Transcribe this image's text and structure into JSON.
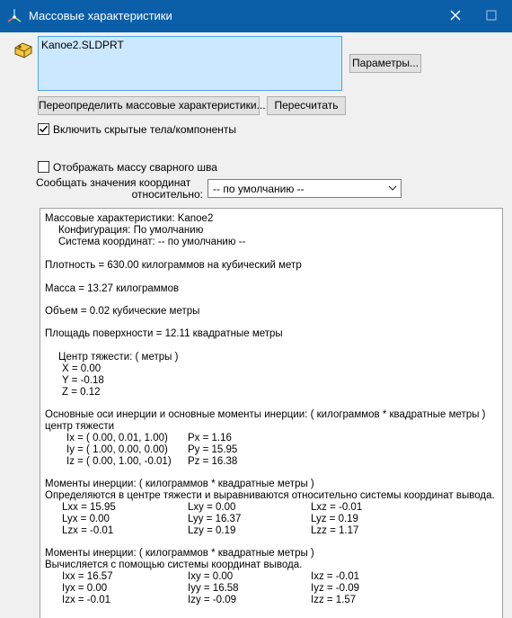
{
  "window": {
    "title": "Массовые характеристики"
  },
  "selection": {
    "items": [
      "Kanoe2.SLDPRT"
    ]
  },
  "buttons": {
    "params": "Параметры...",
    "override": "Переопределить массовые характеристики...",
    "recalculate": "Пересчитать"
  },
  "options": {
    "include_hidden": {
      "label": "Включить скрытые тела/компоненты",
      "checked": true
    },
    "show_weld_mass": {
      "label": "Отображать массу сварного шва",
      "checked": false
    }
  },
  "coord": {
    "label_line1": "Сообщать значения координат",
    "label_line2": "относительно:",
    "selected": "-- по умолчанию --"
  },
  "results": {
    "header": "Массовые характеристики: Kanoe2",
    "config": "Конфигурация: По умолчанию",
    "coord_system": "Система координат: -- по умолчанию --",
    "density": "Плотность = 630.00 килограммов на кубический метр",
    "mass": "Масса = 13.27 килограммов",
    "volume": "Объем = 0.02 кубические метры",
    "surface_area": "Площадь поверхности = 12.11 квадратные метры",
    "cog_title": "Центр тяжести: ( метры )",
    "cog": {
      "x": "X = 0.00",
      "y": "Y = -0.18",
      "z": "Z = 0.12"
    },
    "principal_title": "Основные оси инерции и основные моменты инерции: ( килограммов * квадратные метры )",
    "principal_sub": "центр тяжести",
    "principal_rows": [
      {
        "axis": "Ix = ( 0.00,  0.01,  1.00)",
        "moment": "Px = 1.16"
      },
      {
        "axis": "Iy = ( 1.00,  0.00,  0.00)",
        "moment": "Py = 15.95"
      },
      {
        "axis": "Iz = ( 0.00,  1.00, -0.01)",
        "moment": "Pz = 16.38"
      }
    ],
    "moments_cog_title": "Моменты инерции: ( килограммов * квадратные метры )",
    "moments_cog_sub": "Определяются в центре тяжести и выравниваются относительно системы координат вывода.",
    "moments_cog_rows": [
      [
        "Lxx = 15.95",
        "Lxy = 0.00",
        "Lxz = -0.01"
      ],
      [
        "Lyx = 0.00",
        "Lyy = 16.37",
        "Lyz = 0.19"
      ],
      [
        "Lzx = -0.01",
        "Lzy = 0.19",
        "Lzz = 1.17"
      ]
    ],
    "moments_out_title": "Моменты инерции: ( килограммов * квадратные метры )",
    "moments_out_sub": "Вычисляется с помощью системы координат вывода.",
    "moments_out_rows": [
      [
        "Ixx = 16.57",
        "Ixy = 0.00",
        "Ixz = -0.01"
      ],
      [
        "Iyx = 0.00",
        "Iyy = 16.58",
        "Iyz = -0.09"
      ],
      [
        "Izx = -0.01",
        "Izy = -0.09",
        "Izz = 1.57"
      ]
    ]
  },
  "colors": {
    "titlebar": "#0b5fa8",
    "selection_bg": "#cce8ff",
    "selection_border": "#4da3e0"
  },
  "icons": {
    "app": "axis-triad-icon",
    "part": "part-icon",
    "close": "close-icon",
    "maximize": "maximize-icon",
    "dropdown": "chevron-down-icon",
    "checkmark": "checkmark-icon"
  }
}
